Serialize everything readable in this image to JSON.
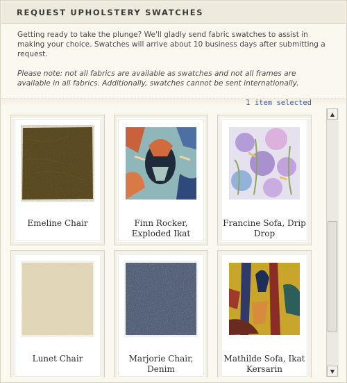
{
  "header": {
    "title": "REQUEST UPHOLSTERY SWATCHES"
  },
  "intro": {
    "text": "Getting ready to take the plunge? We'll gladly send fabric swatches to assist in making your choice. Swatches will arrive about 10 business days after submitting a request.",
    "note": "Please note: not all fabrics are available as swatches and not all frames are available in all fabrics. Additionally, swatches cannot be sent internationally."
  },
  "selection": {
    "count_text": "1 item selected"
  },
  "swatches": [
    {
      "label": "Emeline Chair",
      "icon": "brown-leather-swatch"
    },
    {
      "label": "Finn Rocker, Exploded Ikat",
      "icon": "ikat-swatch"
    },
    {
      "label": "Francine Sofa, Drip Drop",
      "icon": "watercolor-swatch"
    },
    {
      "label": "Lunet Chair",
      "icon": "linen-swatch"
    },
    {
      "label": "Marjorie Chair, Denim",
      "icon": "denim-swatch"
    },
    {
      "label": "Mathilde Sofa, Ikat Kersarin",
      "icon": "ikat-kersarin-swatch"
    }
  ],
  "scrollbar": {
    "up_icon": "arrow-up-icon",
    "down_icon": "arrow-down-icon"
  }
}
